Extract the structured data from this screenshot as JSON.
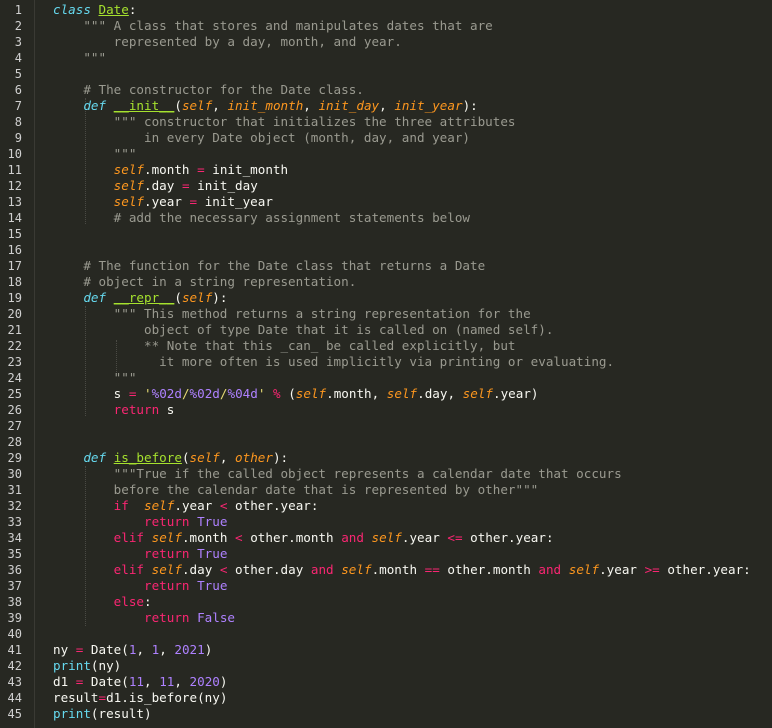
{
  "editor": {
    "line_numbers": [
      "1",
      "2",
      "3",
      "4",
      "5",
      "6",
      "7",
      "8",
      "9",
      "10",
      "11",
      "12",
      "13",
      "14",
      "15",
      "16",
      "17",
      "18",
      "19",
      "20",
      "21",
      "22",
      "23",
      "24",
      "25",
      "26",
      "27",
      "28",
      "29",
      "30",
      "31",
      "32",
      "33",
      "34",
      "35",
      "36",
      "37",
      "38",
      "39",
      "40",
      "41",
      "42",
      "43",
      "44",
      "45"
    ],
    "lines": [
      [
        [
          "def",
          "class"
        ],
        [
          "text",
          " "
        ],
        [
          "cls",
          "Date"
        ],
        [
          "text",
          ":"
        ]
      ],
      [
        [
          "doc",
          "    \"\"\" A class that stores and manipulates dates that are"
        ]
      ],
      [
        [
          "doc",
          "        represented by a day, month, and year."
        ]
      ],
      [
        [
          "doc",
          "    \"\"\""
        ]
      ],
      [],
      [
        [
          "comment",
          "    # The constructor for the Date class."
        ]
      ],
      [
        [
          "text",
          "    "
        ],
        [
          "def",
          "def"
        ],
        [
          "text",
          " "
        ],
        [
          "func",
          "__init__"
        ],
        [
          "text",
          "("
        ],
        [
          "param",
          "self"
        ],
        [
          "text",
          ", "
        ],
        [
          "param",
          "init_month"
        ],
        [
          "text",
          ", "
        ],
        [
          "param",
          "init_day"
        ],
        [
          "text",
          ", "
        ],
        [
          "param",
          "init_year"
        ],
        [
          "text",
          "):"
        ]
      ],
      [
        [
          "doc",
          "        \"\"\" constructor that initializes the three attributes"
        ]
      ],
      [
        [
          "doc",
          "            in every Date object (month, day, and year)"
        ]
      ],
      [
        [
          "doc",
          "        \"\"\""
        ]
      ],
      [
        [
          "text",
          "        "
        ],
        [
          "self",
          "self"
        ],
        [
          "text",
          ".month "
        ],
        [
          "op",
          "="
        ],
        [
          "text",
          " init_month"
        ]
      ],
      [
        [
          "text",
          "        "
        ],
        [
          "self",
          "self"
        ],
        [
          "text",
          ".day "
        ],
        [
          "op",
          "="
        ],
        [
          "text",
          " init_day"
        ]
      ],
      [
        [
          "text",
          "        "
        ],
        [
          "self",
          "self"
        ],
        [
          "text",
          ".year "
        ],
        [
          "op",
          "="
        ],
        [
          "text",
          " init_year"
        ]
      ],
      [
        [
          "comment",
          "        # add the necessary assignment statements below"
        ]
      ],
      [],
      [],
      [
        [
          "comment",
          "    # The function for the Date class that returns a Date"
        ]
      ],
      [
        [
          "comment",
          "    # object in a string representation."
        ]
      ],
      [
        [
          "text",
          "    "
        ],
        [
          "def",
          "def"
        ],
        [
          "text",
          " "
        ],
        [
          "func",
          "__repr__"
        ],
        [
          "text",
          "("
        ],
        [
          "param",
          "self"
        ],
        [
          "text",
          "):"
        ]
      ],
      [
        [
          "doc",
          "        \"\"\" This method returns a string representation for the"
        ]
      ],
      [
        [
          "doc",
          "            object of type Date that it is called on (named self)."
        ]
      ],
      [
        [
          "doc",
          "            ** Note that this _can_ be called explicitly, but"
        ]
      ],
      [
        [
          "doc",
          "              it more often is used implicitly via printing or evaluating."
        ]
      ],
      [
        [
          "doc",
          "        \"\"\""
        ]
      ],
      [
        [
          "text",
          "        s "
        ],
        [
          "op",
          "="
        ],
        [
          "text",
          " "
        ],
        [
          "str",
          "'"
        ],
        [
          "fmt",
          "%02d"
        ],
        [
          "str",
          "/"
        ],
        [
          "fmt",
          "%02d"
        ],
        [
          "str",
          "/"
        ],
        [
          "fmt",
          "%04d"
        ],
        [
          "str",
          "'"
        ],
        [
          "text",
          " "
        ],
        [
          "op",
          "%"
        ],
        [
          "text",
          " ("
        ],
        [
          "self",
          "self"
        ],
        [
          "text",
          ".month, "
        ],
        [
          "self",
          "self"
        ],
        [
          "text",
          ".day, "
        ],
        [
          "self",
          "self"
        ],
        [
          "text",
          ".year)"
        ]
      ],
      [
        [
          "text",
          "        "
        ],
        [
          "kw",
          "return"
        ],
        [
          "text",
          " s"
        ]
      ],
      [],
      [],
      [
        [
          "text",
          "    "
        ],
        [
          "def",
          "def"
        ],
        [
          "text",
          " "
        ],
        [
          "func",
          "is_before"
        ],
        [
          "text",
          "("
        ],
        [
          "param",
          "self"
        ],
        [
          "text",
          ", "
        ],
        [
          "param",
          "other"
        ],
        [
          "text",
          "):"
        ]
      ],
      [
        [
          "doc",
          "        \"\"\"True if the called object represents a calendar date that occurs"
        ]
      ],
      [
        [
          "doc",
          "        before the calendar date that is represented by other\"\"\""
        ]
      ],
      [
        [
          "text",
          "        "
        ],
        [
          "kw",
          "if"
        ],
        [
          "text",
          "  "
        ],
        [
          "self",
          "self"
        ],
        [
          "text",
          ".year "
        ],
        [
          "op",
          "<"
        ],
        [
          "text",
          " other.year:"
        ]
      ],
      [
        [
          "text",
          "            "
        ],
        [
          "kw",
          "return"
        ],
        [
          "text",
          " "
        ],
        [
          "const",
          "True"
        ]
      ],
      [
        [
          "text",
          "        "
        ],
        [
          "kw",
          "elif"
        ],
        [
          "text",
          " "
        ],
        [
          "self",
          "self"
        ],
        [
          "text",
          ".month "
        ],
        [
          "op",
          "<"
        ],
        [
          "text",
          " other.month "
        ],
        [
          "kw",
          "and"
        ],
        [
          "text",
          " "
        ],
        [
          "self",
          "self"
        ],
        [
          "text",
          ".year "
        ],
        [
          "op",
          "<="
        ],
        [
          "text",
          " other.year:"
        ]
      ],
      [
        [
          "text",
          "            "
        ],
        [
          "kw",
          "return"
        ],
        [
          "text",
          " "
        ],
        [
          "const",
          "True"
        ]
      ],
      [
        [
          "text",
          "        "
        ],
        [
          "kw",
          "elif"
        ],
        [
          "text",
          " "
        ],
        [
          "self",
          "self"
        ],
        [
          "text",
          ".day "
        ],
        [
          "op",
          "<"
        ],
        [
          "text",
          " other.day "
        ],
        [
          "kw",
          "and"
        ],
        [
          "text",
          " "
        ],
        [
          "self",
          "self"
        ],
        [
          "text",
          ".month "
        ],
        [
          "op",
          "=="
        ],
        [
          "text",
          " other.month "
        ],
        [
          "kw",
          "and"
        ],
        [
          "text",
          " "
        ],
        [
          "self",
          "self"
        ],
        [
          "text",
          ".year "
        ],
        [
          "op",
          ">="
        ],
        [
          "text",
          " other.year:"
        ]
      ],
      [
        [
          "text",
          "            "
        ],
        [
          "kw",
          "return"
        ],
        [
          "text",
          " "
        ],
        [
          "const",
          "True"
        ]
      ],
      [
        [
          "text",
          "        "
        ],
        [
          "kw",
          "else"
        ],
        [
          "text",
          ":"
        ]
      ],
      [
        [
          "text",
          "            "
        ],
        [
          "kw",
          "return"
        ],
        [
          "text",
          " "
        ],
        [
          "const",
          "False"
        ]
      ],
      [],
      [
        [
          "text",
          "ny "
        ],
        [
          "op",
          "="
        ],
        [
          "text",
          " Date("
        ],
        [
          "num",
          "1"
        ],
        [
          "text",
          ", "
        ],
        [
          "num",
          "1"
        ],
        [
          "text",
          ", "
        ],
        [
          "num",
          "2021"
        ],
        [
          "text",
          ")"
        ]
      ],
      [
        [
          "builtin",
          "print"
        ],
        [
          "text",
          "(ny)"
        ]
      ],
      [
        [
          "text",
          "d1 "
        ],
        [
          "op",
          "="
        ],
        [
          "text",
          " Date("
        ],
        [
          "num",
          "11"
        ],
        [
          "text",
          ", "
        ],
        [
          "num",
          "11"
        ],
        [
          "text",
          ", "
        ],
        [
          "num",
          "2020"
        ],
        [
          "text",
          ")"
        ]
      ],
      [
        [
          "text",
          "result"
        ],
        [
          "op",
          "="
        ],
        [
          "text",
          "d1.is_before(ny)"
        ]
      ],
      [
        [
          "builtin",
          "print"
        ],
        [
          "text",
          "(result)"
        ]
      ]
    ]
  }
}
